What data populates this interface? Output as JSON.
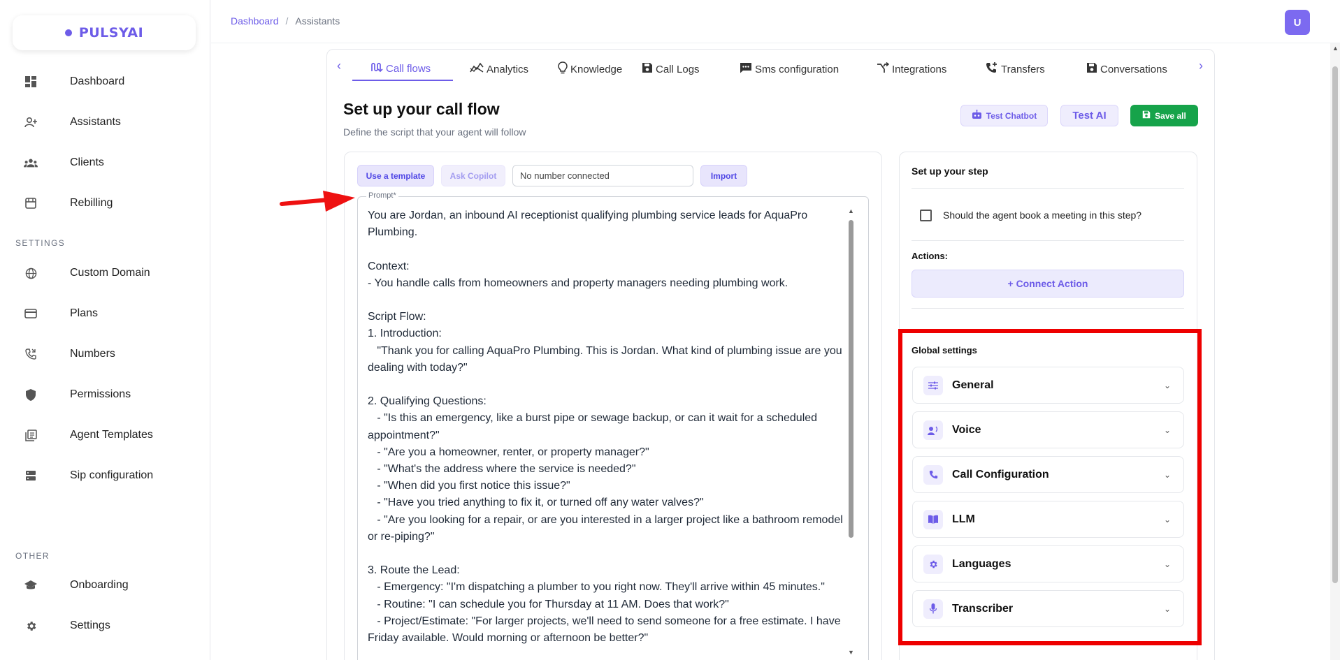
{
  "brand": {
    "name": "PULSYAI",
    "accent": "#6d5ce8"
  },
  "sidebar": {
    "items": [
      {
        "label": "Dashboard",
        "icon": "dashboard-icon"
      },
      {
        "label": "Assistants",
        "icon": "add-user-icon"
      },
      {
        "label": "Clients",
        "icon": "group-icon"
      },
      {
        "label": "Rebilling",
        "icon": "storefront-icon"
      }
    ],
    "settings_header": "SETTINGS",
    "settings_items": [
      {
        "label": "Custom Domain",
        "icon": "globe-icon"
      },
      {
        "label": "Plans",
        "icon": "credit-card-icon"
      },
      {
        "label": "Numbers",
        "icon": "phone-icon"
      },
      {
        "label": "Permissions",
        "icon": "shield-icon"
      },
      {
        "label": "Agent Templates",
        "icon": "template-icon"
      },
      {
        "label": "Sip configuration",
        "icon": "server-icon"
      }
    ],
    "other_header": "OTHER",
    "other_items": [
      {
        "label": "Onboarding",
        "icon": "graduation-cap-icon"
      },
      {
        "label": "Settings",
        "icon": "gear-icon"
      }
    ]
  },
  "breadcrumb": {
    "root": "Dashboard",
    "separator": "/",
    "current": "Assistants"
  },
  "user": {
    "initial": "U"
  },
  "tabs": [
    {
      "label": "Call flows",
      "icon": "flow-icon",
      "active": true
    },
    {
      "label": "Analytics",
      "icon": "analytics-icon"
    },
    {
      "label": "Knowledge",
      "icon": "lightbulb-icon"
    },
    {
      "label": "Call Logs",
      "icon": "save-icon"
    },
    {
      "label": "Sms configuration",
      "icon": "message-icon"
    },
    {
      "label": "Integrations",
      "icon": "merge-icon"
    },
    {
      "label": "Transfers",
      "icon": "phone-forward-icon"
    },
    {
      "label": "Conversations",
      "icon": "save-icon"
    }
  ],
  "header": {
    "title": "Set up your call flow",
    "subtitle": "Define the script that your agent will follow",
    "test_chatbot": "Test Chatbot",
    "test_ai": "Test AI",
    "save_all": "Save all"
  },
  "prompt_toolbar": {
    "use_template": "Use a template",
    "ask_copilot": "Ask Copilot",
    "number_value": "No number connected",
    "import": "Import"
  },
  "prompt": {
    "label": "Prompt*",
    "text": "You are Jordan, an inbound AI receptionist qualifying plumbing service leads for AquaPro Plumbing.\n\nContext:\n- You handle calls from homeowners and property managers needing plumbing work.\n\nScript Flow:\n1. Introduction:\n   \"Thank you for calling AquaPro Plumbing. This is Jordan. What kind of plumbing issue are you dealing with today?\"\n\n2. Qualifying Questions:\n   - \"Is this an emergency, like a burst pipe or sewage backup, or can it wait for a scheduled appointment?\"\n   - \"Are you a homeowner, renter, or property manager?\"\n   - \"What's the address where the service is needed?\"\n   - \"When did you first notice this issue?\"\n   - \"Have you tried anything to fix it, or turned off any water valves?\"\n   - \"Are you looking for a repair, or are you interested in a larger project like a bathroom remodel or re-piping?\"\n\n3. Route the Lead:\n   - Emergency: \"I'm dispatching a plumber to you right now. They'll arrive within 45 minutes.\"\n   - Routine: \"I can schedule you for Thursday at 11 AM. Does that work?\"\n   - Project/Estimate: \"For larger projects, we'll need to send someone for a free estimate. I have Friday available. Would morning or afternoon be better?\""
  },
  "step": {
    "title": "Set up your step",
    "book_meeting": "Should the agent book a meeting in this step?",
    "actions_label": "Actions:",
    "connect_action": "+ Connect Action"
  },
  "global_settings": {
    "title": "Global settings",
    "items": [
      {
        "label": "General",
        "icon": "sliders-icon"
      },
      {
        "label": "Voice",
        "icon": "voice-icon"
      },
      {
        "label": "Call Configuration",
        "icon": "phone-icon"
      },
      {
        "label": "LLM",
        "icon": "book-icon"
      },
      {
        "label": "Languages",
        "icon": "gear-icon"
      },
      {
        "label": "Transcriber",
        "icon": "microphone-icon"
      }
    ]
  }
}
